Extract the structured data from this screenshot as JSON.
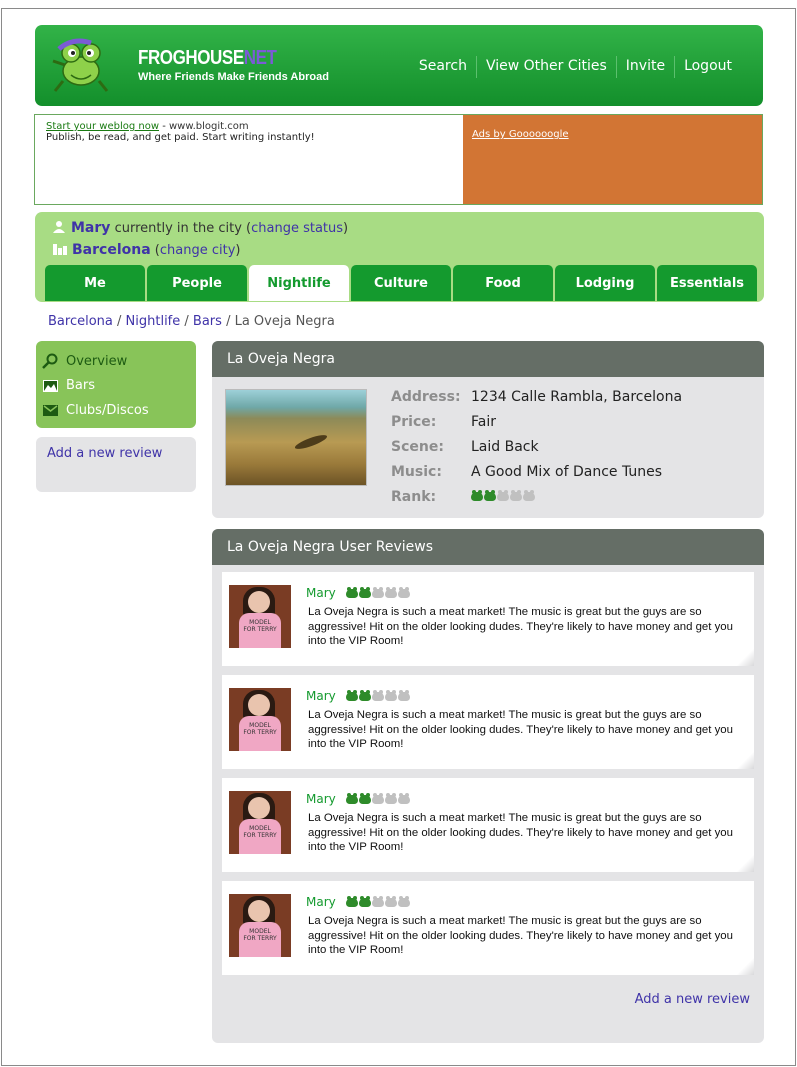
{
  "header": {
    "brand_main": "FROGHOUSE",
    "brand_suffix": "NET",
    "tagline": "Where Friends Make Friends Abroad",
    "nav": [
      "Search",
      "View Other Cities",
      "Invite",
      "Logout"
    ]
  },
  "ad": {
    "link_text": "Start your weblog now",
    "separator": " - ",
    "url": "www.blogit.com",
    "body": "Publish, be read, and get paid. Start writing instantly!",
    "ads_by": "Ads by Goooooogle",
    "colors": {
      "ad_panel": "#d27534"
    }
  },
  "status": {
    "user": "Mary",
    "status_text": "currently in the city",
    "change_status": "change status",
    "city": "Barcelona",
    "change_city": "change city"
  },
  "tabs": [
    {
      "label": "Me",
      "active": false
    },
    {
      "label": "People",
      "active": false
    },
    {
      "label": "Nightlife",
      "active": true
    },
    {
      "label": "Culture",
      "active": false
    },
    {
      "label": "Food",
      "active": false
    },
    {
      "label": "Lodging",
      "active": false
    },
    {
      "label": "Essentials",
      "active": false
    }
  ],
  "breadcrumb": {
    "items": [
      "Barcelona",
      "Nightlife",
      "Bars"
    ],
    "separator": " / ",
    "current": "La Oveja Negra"
  },
  "sidebar": {
    "items": [
      {
        "label": "Overview",
        "icon": "search-icon"
      },
      {
        "label": "Bars",
        "icon": "picture-icon"
      },
      {
        "label": "Clubs/Discos",
        "icon": "envelope-icon"
      }
    ],
    "add_review": "Add a new review"
  },
  "venue": {
    "title": "La Oveja Negra",
    "details": [
      {
        "label": "Address:",
        "value": "1234 Calle Rambla, Barcelona"
      },
      {
        "label": "Price:",
        "value": "Fair"
      },
      {
        "label": "Scene:",
        "value": "Laid Back"
      },
      {
        "label": "Music:",
        "value": "A Good Mix of Dance Tunes"
      },
      {
        "label": "Rank:",
        "value": ""
      }
    ],
    "rank": {
      "filled": 2,
      "total": 5
    }
  },
  "reviews": {
    "title": "La Oveja Negra User Reviews",
    "items": [
      {
        "user": "Mary",
        "rating": 2,
        "text": "La Oveja Negra is such a meat market! The music is great but the guys are so aggressive! Hit on the older looking dudes. They're likely to have money and get you into the VIP Room!"
      },
      {
        "user": "Mary",
        "rating": 2,
        "text": "La Oveja Negra is such a meat market! The music is great but the guys are so aggressive! Hit on the older looking dudes. They're likely to have money and get you into the VIP Room!"
      },
      {
        "user": "Mary",
        "rating": 2,
        "text": "La Oveja Negra is such a meat market! The music is great but the guys are so aggressive! Hit on the older looking dudes. They're likely to have money and get you into the VIP Room!"
      },
      {
        "user": "Mary",
        "rating": 2,
        "text": "La Oveja Negra is such a meat market! The music is great but the guys are so aggressive! Hit on the older looking dudes. They're likely to have money and get you into the VIP Room!"
      }
    ],
    "add_review": "Add a new review",
    "shirt_text": "MODEL FOR TERRY"
  },
  "colors": {
    "brand_green": "#149a2e",
    "link_purple": "#3f33a8",
    "panel_grey": "#e4e4e6",
    "title_bar": "#656e66"
  }
}
